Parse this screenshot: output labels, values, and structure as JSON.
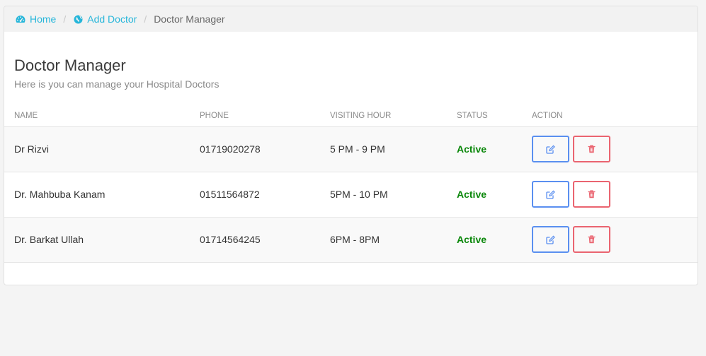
{
  "breadcrumb": {
    "separator": "/",
    "items": [
      {
        "label": "Home",
        "icon": "dashboard-icon"
      },
      {
        "label": "Add Doctor",
        "icon": "globe-icon"
      },
      {
        "label": "Doctor Manager"
      }
    ]
  },
  "page": {
    "title": "Doctor Manager",
    "subtitle": "Here is you can manage your Hospital Doctors"
  },
  "table": {
    "columns": [
      "NAME",
      "PHONE",
      "VISITING HOUR",
      "STATUS",
      "ACTION"
    ],
    "rows": [
      {
        "name": "Dr Rizvi",
        "phone": "01719020278",
        "visiting_hour": "5 PM - 9 PM",
        "status": "Active"
      },
      {
        "name": "Dr. Mahbuba Kanam",
        "phone": "01511564872",
        "visiting_hour": "5PM - 10 PM",
        "status": "Active"
      },
      {
        "name": "Dr. Barkat Ullah",
        "phone": "01714564245",
        "visiting_hour": "6PM - 8PM",
        "status": "Active"
      }
    ],
    "row_actions": [
      {
        "icon": "edit-icon"
      },
      {
        "icon": "trash-icon"
      }
    ]
  },
  "colors": {
    "link": "#26b6da",
    "status_active": "#0a870a",
    "edit_button": "#5a8ff0",
    "delete_button": "#ea6470"
  }
}
